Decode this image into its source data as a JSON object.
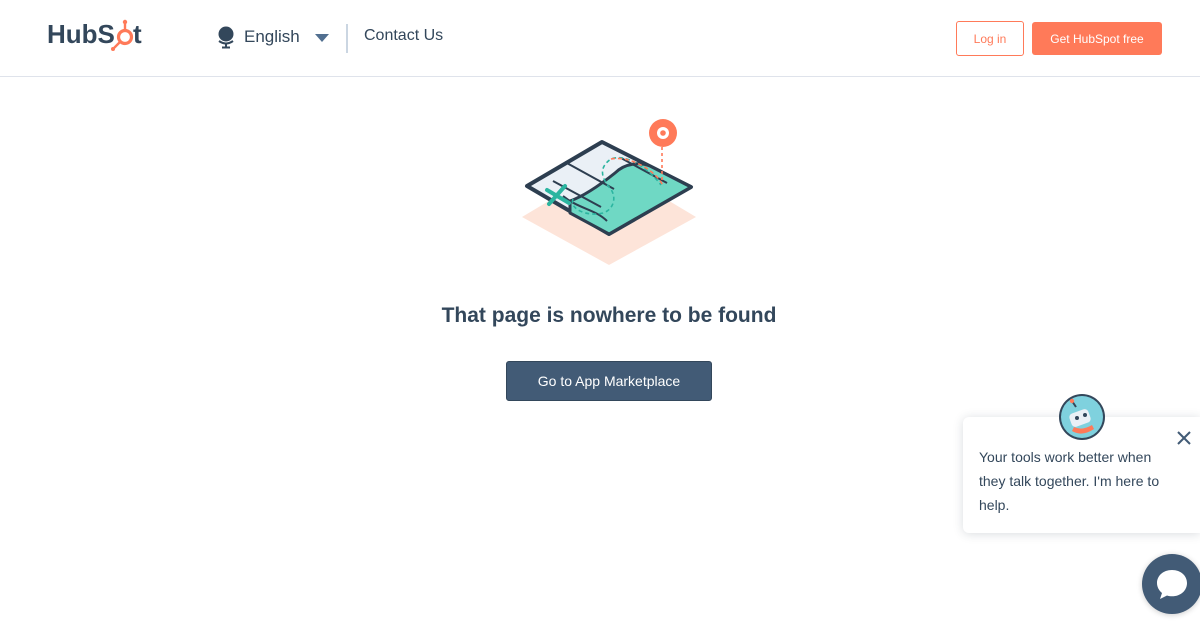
{
  "header": {
    "logo_text": "HubSpot",
    "language_label": "English",
    "contact_label": "Contact Us",
    "login_label": "Log in",
    "signup_label": "Get HubSpot free"
  },
  "icons": {
    "logo": "hubspot-logo",
    "language": "globe-icon",
    "dropdown": "caret-down-icon",
    "illustration": "map-illustration",
    "close": "close-icon",
    "bot": "chatbot-avatar",
    "launcher": "chat-bubble-icon"
  },
  "main": {
    "title": "That page is nowhere to be found",
    "button_label": "Go to App Marketplace"
  },
  "chat": {
    "message": "Your tools work better when they talk together. I'm here to help."
  },
  "colors": {
    "brand_orange": "#ff7a59",
    "primary_text": "#33475b",
    "button_dark": "#425b76",
    "map_teal": "#6fd8c4",
    "map_peach": "#fde4d9"
  }
}
